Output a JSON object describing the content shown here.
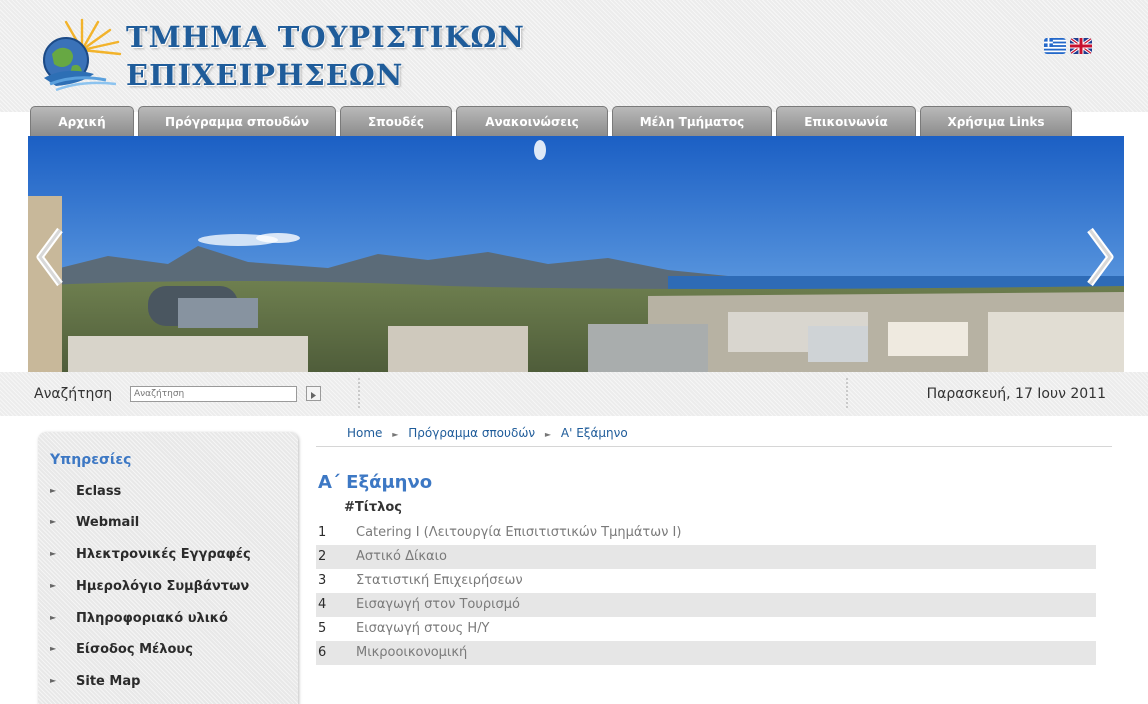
{
  "header": {
    "logo_line1": "ΤΜΗΜΑ ΤΟΥΡΙΣΤΙΚΩΝ",
    "logo_line2": "ΕΠΙΧΕΙΡΗΣΕΩΝ",
    "languages": [
      "Greek flag",
      "UK flag"
    ]
  },
  "nav": {
    "tabs": [
      {
        "label": "Αρχική"
      },
      {
        "label": "Πρόγραμμα σπουδών"
      },
      {
        "label": "Σπουδές"
      },
      {
        "label": "Ανακοινώσεις"
      },
      {
        "label": "Μέλη Τμήματος"
      },
      {
        "label": "Επικοινωνία"
      },
      {
        "label": "Χρήσιμα Links"
      }
    ]
  },
  "banner": {
    "icon_prev": "chevron-left-icon",
    "icon_next": "chevron-right-icon"
  },
  "search": {
    "label": "Αναζήτηση",
    "placeholder": "Αναζήτηση",
    "button_icon": "play-arrow-icon"
  },
  "date_text": "Παρασκευή, 17 Ιουν 2011",
  "sidebar": {
    "title": "Υπηρεσίες",
    "items": [
      {
        "label": "Eclass"
      },
      {
        "label": "Webmail"
      },
      {
        "label": "Ηλεκτρονικές Εγγραφές"
      },
      {
        "label": "Ημερολόγιο Συμβάντων"
      },
      {
        "label": "Πληροφοριακό υλικό"
      },
      {
        "label": "Είσοδος Μέλους"
      },
      {
        "label": "Site Map"
      }
    ]
  },
  "breadcrumb": {
    "items": [
      "Home",
      "Πρόγραμμα σπουδών",
      "Α' Εξάμηνο"
    ]
  },
  "main": {
    "title": "Α΄ Εξάμηνο",
    "column_header": "#Τίτλος",
    "courses": [
      {
        "num": "1",
        "title": "Catering I (Λειτουργία Επισιτιστικών Τμημάτων I)"
      },
      {
        "num": "2",
        "title": "Αστικό Δίκαιο"
      },
      {
        "num": "3",
        "title": "Στατιστική Επιχειρήσεων"
      },
      {
        "num": "4",
        "title": "Εισαγωγή στον Τουρισμό"
      },
      {
        "num": "5",
        "title": "Εισαγωγή στους Η/Υ"
      },
      {
        "num": "6",
        "title": "Μικροοικονομική"
      }
    ]
  }
}
